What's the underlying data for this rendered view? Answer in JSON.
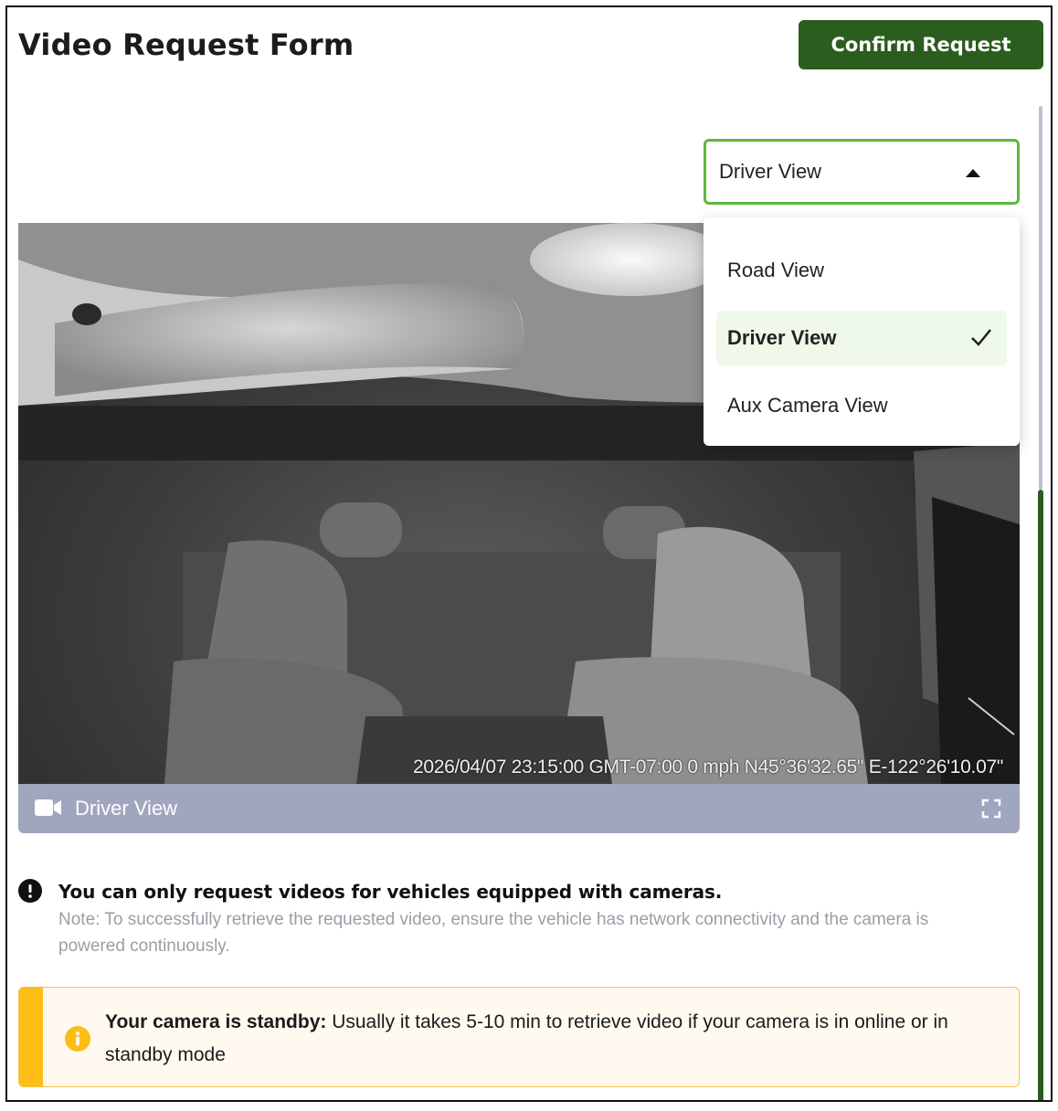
{
  "header": {
    "title": "Video Request Form",
    "confirm_label": "Confirm Request"
  },
  "view_select": {
    "selected": "Driver View",
    "options": [
      {
        "label": "Road View",
        "selected": false
      },
      {
        "label": "Driver View",
        "selected": true
      },
      {
        "label": "Aux Camera View",
        "selected": false
      }
    ]
  },
  "video": {
    "overlay": "2026/04/07 23:15:00 GMT-07:00   0 mph   N45°36'32.65\"  E-122°26'10.07\"",
    "label": "Driver View"
  },
  "notice": {
    "title": "You can only request videos for vehicles equipped with cameras.",
    "note": "Note: To successfully retrieve the requested video, ensure the vehicle has network connectivity and the camera is powered continuously."
  },
  "warning": {
    "bold": "Your camera is standby:",
    "text": " Usually it takes 5-10 min to retrieve video if your camera is in online or in standby mode"
  },
  "colors": {
    "primary": "#2b5d1e",
    "select_border": "#5cb83a",
    "selected_bg": "#eef9ea",
    "video_bar": "#a0a6bd",
    "warning_stripe": "#fbbd16",
    "warning_bg": "#fff9ef"
  }
}
